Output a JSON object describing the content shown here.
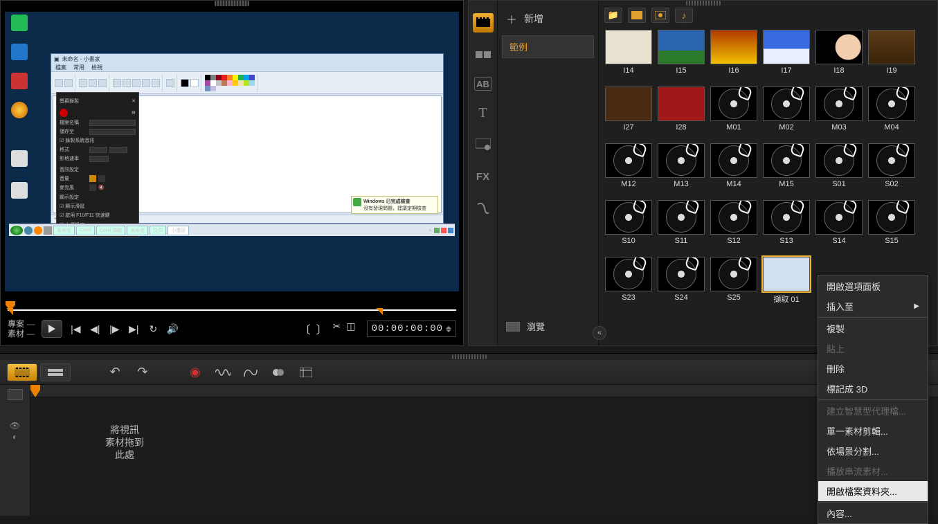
{
  "preview": {
    "mode_project": "專案",
    "mode_clip": "素材",
    "timecode": "00:00:00:00"
  },
  "library": {
    "add_label": "新增",
    "folder_label": "範例",
    "browse_label": "瀏覽",
    "thumbs": [
      {
        "label": "I14",
        "kind": "img",
        "bg": "#e8e2d0"
      },
      {
        "label": "I15",
        "kind": "img",
        "bg": "linear-gradient(#2a63b0 60%,#2c7a2c 60%)"
      },
      {
        "label": "I16",
        "kind": "img",
        "bg": "linear-gradient(#b33a00,#f0c000)"
      },
      {
        "label": "I17",
        "kind": "img",
        "bg": "linear-gradient(#3a6adf 55%,#e8f0ff 55%)"
      },
      {
        "label": "I18",
        "kind": "img",
        "bg": "radial-gradient(circle at 70% 50%,#f2cfae 0 18px,#000 19px)"
      },
      {
        "label": "I19",
        "kind": "img",
        "bg": "linear-gradient(#5a3a18,#3a2408)"
      },
      {
        "label": "I27",
        "kind": "img",
        "bg": "#4a2a10"
      },
      {
        "label": "I28",
        "kind": "img",
        "bg": "#a01818"
      },
      {
        "label": "M01",
        "kind": "audio"
      },
      {
        "label": "M02",
        "kind": "audio"
      },
      {
        "label": "M03",
        "kind": "audio"
      },
      {
        "label": "M04",
        "kind": "audio"
      },
      {
        "label": "M12",
        "kind": "audio"
      },
      {
        "label": "M13",
        "kind": "audio"
      },
      {
        "label": "M14",
        "kind": "audio"
      },
      {
        "label": "M15",
        "kind": "audio"
      },
      {
        "label": "S01",
        "kind": "audio"
      },
      {
        "label": "S02",
        "kind": "audio"
      },
      {
        "label": "S10",
        "kind": "audio"
      },
      {
        "label": "S11",
        "kind": "audio"
      },
      {
        "label": "S12",
        "kind": "audio"
      },
      {
        "label": "S13",
        "kind": "audio"
      },
      {
        "label": "S14",
        "kind": "audio"
      },
      {
        "label": "S15",
        "kind": "audio"
      },
      {
        "label": "S23",
        "kind": "audio"
      },
      {
        "label": "S24",
        "kind": "audio"
      },
      {
        "label": "S25",
        "kind": "audio"
      },
      {
        "label": "擷取 01",
        "kind": "img",
        "bg": "#d0e0f0",
        "selected": true
      }
    ]
  },
  "context_menu": {
    "items": [
      {
        "label": "開啟選項面板",
        "enabled": true
      },
      {
        "label": "插入至",
        "enabled": true,
        "submenu": true,
        "sep_after": true
      },
      {
        "label": "複製",
        "enabled": true
      },
      {
        "label": "貼上",
        "enabled": false
      },
      {
        "label": "刪除",
        "enabled": true
      },
      {
        "label": "標記成 3D",
        "enabled": true,
        "sep_after": true
      },
      {
        "label": "建立智慧型代理檔...",
        "enabled": false
      },
      {
        "label": "單一素材剪輯...",
        "enabled": true
      },
      {
        "label": "依場景分割...",
        "enabled": true
      },
      {
        "label": "播放串流素材...",
        "enabled": false
      },
      {
        "label": "開啟檔案資料夾...",
        "enabled": true,
        "hover": true,
        "sep_after": true
      },
      {
        "label": "內容...",
        "enabled": true
      }
    ]
  },
  "timeline": {
    "drop_hint": "將視訊\n素材拖到\n此處"
  },
  "palette_colors": [
    "#000",
    "#7f7f7f",
    "#880015",
    "#ed1c24",
    "#ff7f27",
    "#fff200",
    "#22b14c",
    "#00a2e8",
    "#3f48cc",
    "#a349a4",
    "#fff",
    "#c3c3c3",
    "#b97a57",
    "#ffaec9",
    "#ffc90e",
    "#efe4b0",
    "#b5e61d",
    "#99d9ea",
    "#7092be",
    "#c8bfe7"
  ]
}
